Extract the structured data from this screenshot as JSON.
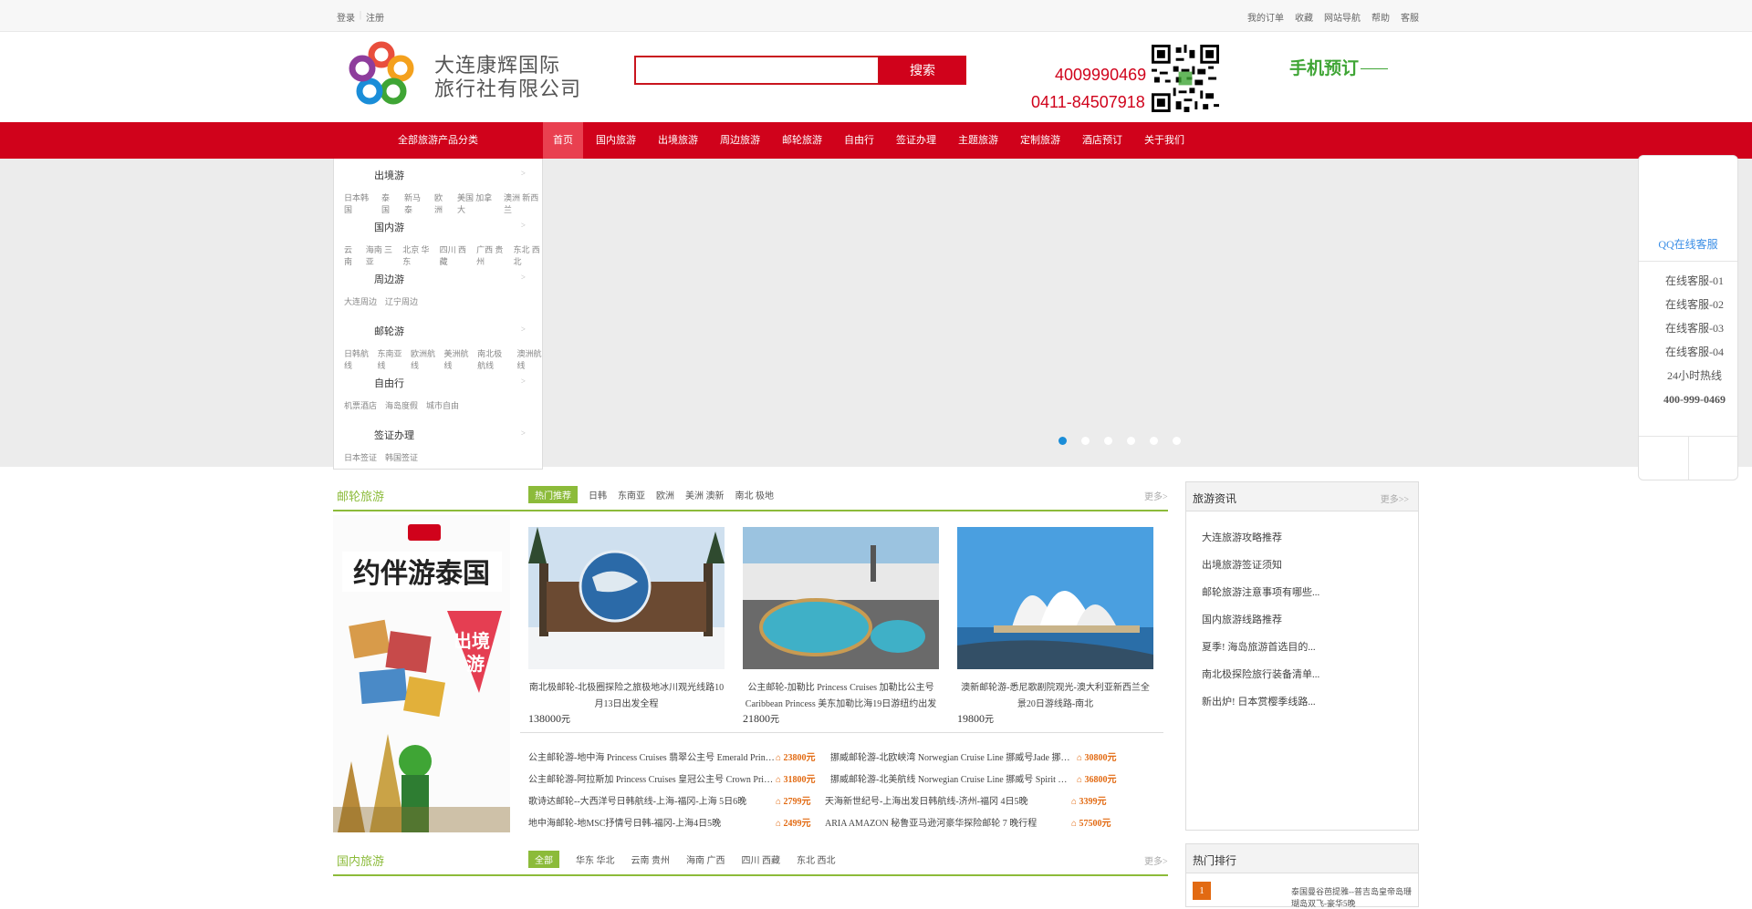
{
  "topbar": {
    "left": [
      "登录",
      "注册"
    ],
    "right": [
      "我的订单",
      "收藏",
      "网站导航",
      "帮助",
      "客服"
    ]
  },
  "header": {
    "logo_line1": "大连康辉国际",
    "logo_line2": "旅行社有限公司",
    "search_placeholder": "",
    "search_button": "搜索",
    "phone1": "4009990469",
    "phone2": "0411-84507918",
    "mobile_book": "手机预订"
  },
  "nav": {
    "category": "全部旅游产品分类",
    "items": [
      "首页",
      "国内旅游",
      "出境旅游",
      "周边旅游",
      "邮轮旅游",
      "自由行",
      "签证办理",
      "主题旅游",
      "定制旅游",
      "酒店预订",
      "关于我们"
    ]
  },
  "sidemenu": [
    {
      "title": "出境游",
      "links": [
        "日本韩国",
        "泰国",
        "新马泰",
        "欧洲",
        "美国 加拿大",
        "澳洲 新西兰"
      ]
    },
    {
      "title": "国内游",
      "links": [
        "云南",
        "海南 三亚",
        "北京 华东",
        "四川 西藏",
        "广西 贵州",
        "东北 西北"
      ]
    },
    {
      "title": "周边游",
      "links": [
        "大连周边",
        "辽宁周边"
      ]
    },
    {
      "title": "邮轮游",
      "links": [
        "日韩航线",
        "东南亚线",
        "欧洲航线",
        "美洲航线",
        "南北极航线",
        "澳洲航线"
      ]
    },
    {
      "title": "自由行",
      "links": [
        "机票酒店",
        "海岛度假",
        "城市自由"
      ]
    },
    {
      "title": "签证办理",
      "links": [
        "日本签证",
        "韩国签证"
      ]
    }
  ],
  "banner": {
    "dots": 6,
    "active": 0
  },
  "float": {
    "qq_title": "QQ在线客服",
    "items": [
      "在线客服-01",
      "在线客服-02",
      "在线客服-03",
      "在线客服-04",
      "24小时热线"
    ],
    "hotline": "400-999-0469"
  },
  "section1": {
    "title": "邮轮旅游",
    "tabs": [
      "热门推荐",
      "日韩",
      "东南亚",
      "欧洲",
      "美洲 澳新",
      "南北 极地"
    ],
    "more": "更多>",
    "cards": [
      {
        "title": "南北极邮轮-北极圈探险之旅极地冰川观光线路10月13日出发全程",
        "price": "138000",
        "unit": "元"
      },
      {
        "title": "公主邮轮-加勒比 Princess Cruises 加勒比公主号 Caribbean Princess 美东加勒比海19日游纽约出发",
        "price": "21800",
        "unit": "元"
      },
      {
        "title": "澳新邮轮游-悉尼歌剧院观光-澳大利亚新西兰全景20日游线路-南北",
        "price": "19800",
        "unit": "元"
      }
    ],
    "rows": [
      {
        "text": "公主邮轮游-地中海 Princess Cruises 翡翠公主号 Emerald Princess 欧洲地中海",
        "price": "23800",
        "unit": "元"
      },
      {
        "text": "挪威邮轮游-北欧峡湾 Norwegian Cruise Line 挪威号Jade 挪威峡湾北欧航线畅游",
        "price": "30800",
        "unit": "元"
      },
      {
        "text": "公主邮轮游-阿拉斯加 Princess Cruises 皇冠公主号 Crown Princess 阿拉斯加冰川",
        "price": "31800",
        "unit": "元"
      },
      {
        "text": "挪威邮轮游-北美航线 Norwegian Cruise Line 挪威号 Spirit 美加东海岸新英格兰",
        "price": "36800",
        "unit": "元"
      },
      {
        "text": "歌诗达邮轮--大西洋号日韩航线-上海-福冈-上海 5日6晚",
        "price": "2799",
        "unit": "元"
      },
      {
        "text": "天海新世纪号-上海出发日韩航线-济州-福冈 4日5晚",
        "price": "3399",
        "unit": "元"
      },
      {
        "text": "地中海邮轮-地MSC抒情号日韩-福冈-上海4日5晚",
        "price": "2499",
        "unit": "元"
      },
      {
        "text": "ARIA AMAZON 秘鲁亚马逊河豪华探险邮轮 7 晚行程",
        "price": "57500",
        "unit": "元"
      }
    ]
  },
  "hotbox": {
    "title": "旅游资讯",
    "more": "更多>>",
    "items": [
      "大连旅游攻略推荐",
      "出境旅游签证须知",
      "邮轮旅游注意事项有哪些...",
      "国内旅游线路推荐",
      "夏季! 海岛旅游首选目的...",
      "南北极探险旅行装备清单...",
      "新出炉! 日本赏樱季线路..."
    ]
  },
  "section2": {
    "title": "国内旅游",
    "tabs": [
      "全部",
      "华东 华北",
      "云南 贵州",
      "海南 广西",
      "四川 西藏",
      "东北 西北"
    ],
    "more": "更多>"
  },
  "notice": {
    "title": "热门排行",
    "first_no": "1",
    "first_text": "泰国曼谷芭提雅--普吉岛皇帝岛珊瑚岛双飞-豪华5晚"
  },
  "colors": {
    "brand_red": "#d0021b",
    "green": "#8cbb3a",
    "orange": "#e26a12",
    "blue": "#1a8dd8"
  }
}
